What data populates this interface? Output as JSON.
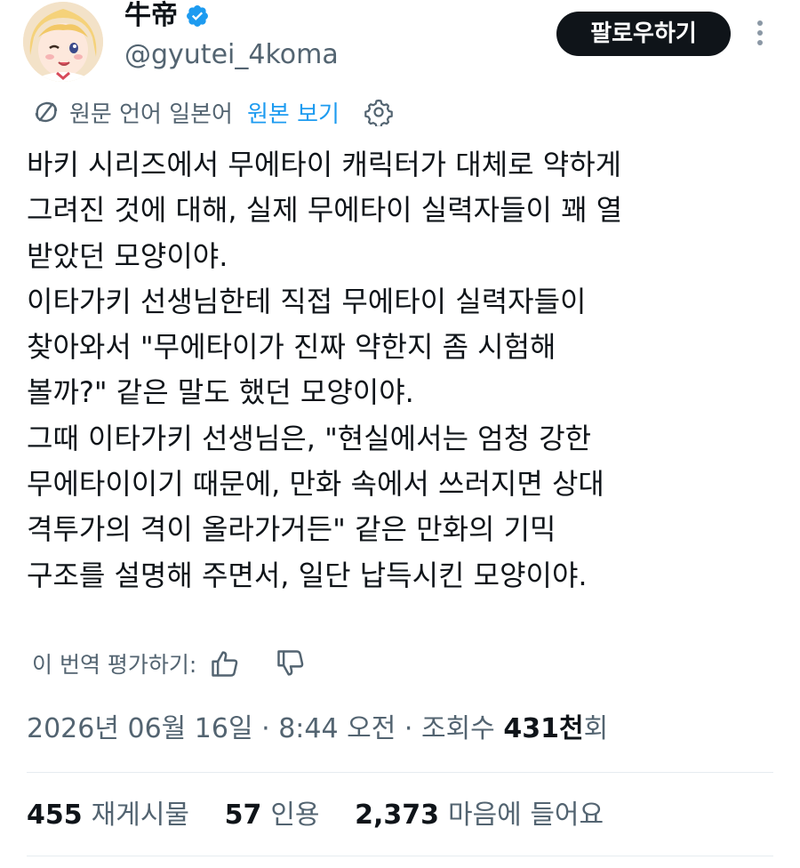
{
  "author": {
    "name": "牛帝",
    "handle": "@gyutei_4koma"
  },
  "follow_label": "팔로우하기",
  "translation": {
    "source_language": "원문 언어 일본어",
    "view_original": "원본 보기"
  },
  "tweet_lines": [
    "바키 시리즈에서 무에타이 캐릭터가 대체로 약하게",
    "그려진 것에 대해, 실제 무에타이 실력자들이 꽤 열",
    "받았던 모양이야.",
    "이타가키 선생님한테 직접 무에타이 실력자들이",
    "찾아와서 \"무에타이가 진짜 약한지 좀 시험해",
    "볼까?\" 같은 말도 했던 모양이야.",
    "그때 이타가키 선생님은, \"현실에서는 엄청 강한",
    "무에타이이기 때문에, 만화 속에서 쓰러지면 상대",
    "격투가의 격이 올라가거든\" 같은 만화의 기믹",
    "구조를 설명해 주면서, 일단 납득시킨 모양이야."
  ],
  "rate_translation": "이 번역 평가하기:",
  "meta": {
    "date": "2026년 06월 16일",
    "time": "8:44 오전",
    "views_prefix": "조회수",
    "views_count": "431천",
    "views_suffix": "회",
    "separator": "·"
  },
  "stats": {
    "retweets_count": "455",
    "retweets_label": "재게시물",
    "quotes_count": "57",
    "quotes_label": "인용",
    "likes_count": "2,373",
    "likes_label": "마음에 들어요"
  },
  "colors": {
    "link": "#1d9bf0",
    "secondary_text": "#536471",
    "primary_text": "#0f1419",
    "follow_bg": "#0f1419"
  },
  "icons": [
    "verified-badge-icon",
    "translate-icon",
    "gear-icon",
    "thumbs-up-icon",
    "thumbs-down-icon",
    "more-options-icon"
  ]
}
